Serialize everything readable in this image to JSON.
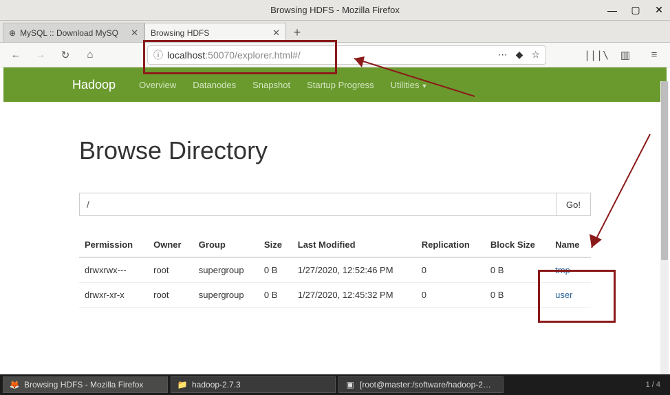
{
  "window": {
    "title": "Browsing HDFS - Mozilla Firefox"
  },
  "tabs": [
    {
      "label": "MySQL :: Download MySQ",
      "active": false
    },
    {
      "label": "Browsing HDFS",
      "active": true
    }
  ],
  "urlbar": {
    "host": "localhost",
    "port_path": ":50070/explorer.html#/"
  },
  "hadoop_nav": {
    "brand": "Hadoop",
    "links": [
      "Overview",
      "Datanodes",
      "Snapshot",
      "Startup Progress",
      "Utilities"
    ]
  },
  "page": {
    "heading": "Browse Directory",
    "path_value": "/",
    "go_label": "Go!"
  },
  "table": {
    "columns": [
      "Permission",
      "Owner",
      "Group",
      "Size",
      "Last Modified",
      "Replication",
      "Block Size",
      "Name"
    ],
    "rows": [
      {
        "permission": "drwxrwx---",
        "owner": "root",
        "group": "supergroup",
        "size": "0 B",
        "modified": "1/27/2020, 12:52:46 PM",
        "replication": "0",
        "block_size": "0 B",
        "name": "tmp"
      },
      {
        "permission": "drwxr-xr-x",
        "owner": "root",
        "group": "supergroup",
        "size": "0 B",
        "modified": "1/27/2020, 12:45:32 PM",
        "replication": "0",
        "block_size": "0 B",
        "name": "user"
      }
    ]
  },
  "taskbar": {
    "items": [
      {
        "label": "Browsing HDFS - Mozilla Firefox",
        "icon": "🦊",
        "active": true
      },
      {
        "label": "hadoop-2.7.3",
        "icon": "📁",
        "active": false
      },
      {
        "label": "[root@master:/software/hadoop-2…",
        "icon": "▣",
        "active": false
      }
    ],
    "right": "1 / 4"
  }
}
